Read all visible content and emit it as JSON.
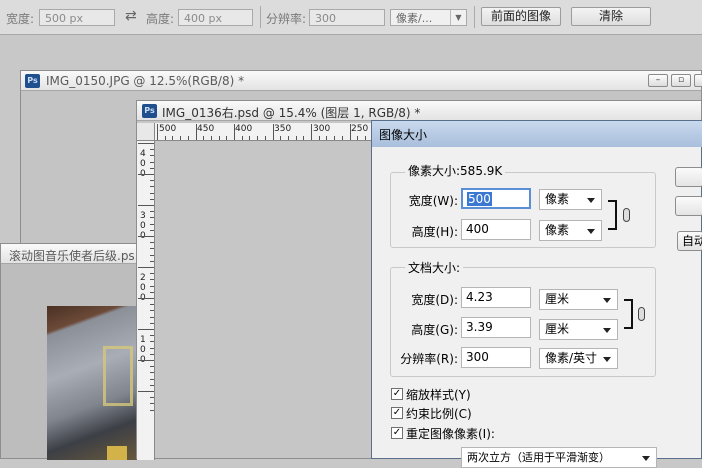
{
  "options_bar": {
    "width_label": "宽度:",
    "width_value": "500 px",
    "height_label": "高度:",
    "height_value": "400 px",
    "resolution_label": "分辨率:",
    "resolution_value": "300",
    "resolution_unit": "像素/...",
    "front_image_button": "前面的图像",
    "clear_button": "清除"
  },
  "windows": {
    "back_title": "IMG_0150.JPG @ 12.5%(RGB/8) *",
    "front_title": "IMG_0136右.psd @ 15.4% (图层 1, RGB/8) *",
    "left_title": "滚动图音乐使者后级.ps",
    "ps_logo": "Ps",
    "ruler_h": [
      "500",
      "450",
      "400",
      "350",
      "300",
      "250"
    ],
    "ruler_v": [
      "4 0 0",
      "3 0 0",
      "2 0 0",
      "1 0 0"
    ]
  },
  "dialog": {
    "title": "图像大小",
    "pixel_dims_label": "像素大小:585.9K",
    "pixel_width_label": "宽度(W):",
    "pixel_width_value": "500",
    "pixel_width_unit": "像素",
    "pixel_height_label": "高度(H):",
    "pixel_height_value": "400",
    "pixel_height_unit": "像素",
    "doc_size_label": "文档大小:",
    "doc_width_label": "宽度(D):",
    "doc_width_value": "4.23",
    "doc_width_unit": "厘米",
    "doc_height_label": "高度(G):",
    "doc_height_value": "3.39",
    "doc_height_unit": "厘米",
    "resolution_label": "分辨率(R):",
    "resolution_value": "300",
    "resolution_unit": "像素/英寸",
    "scale_styles": "缩放样式(Y)",
    "constrain": "约束比例(C)",
    "resample": "重定图像像素(I):",
    "resample_method": "两次立方（适用于平滑渐变）",
    "auto_button": "自动"
  }
}
